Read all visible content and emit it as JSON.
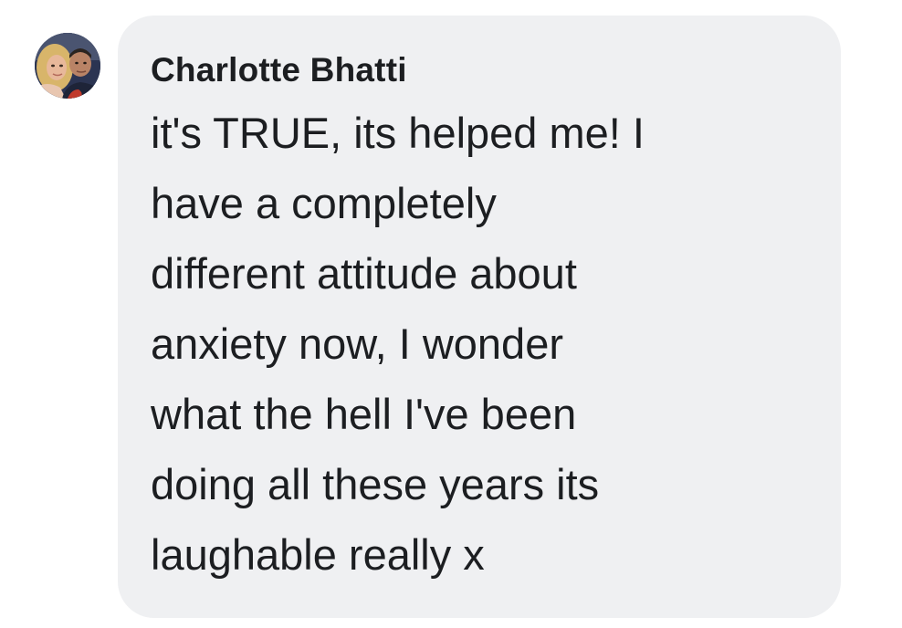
{
  "comment": {
    "author": "Charlotte Bhatti",
    "avatar_icon": "profile-photo-avatar",
    "bubble_color": "#eff0f2",
    "text_color": "#1c1e21",
    "lines": [
      "it's TRUE, its helped me! I",
      "have a completely",
      "different attitude about",
      "anxiety now, I wonder",
      "what the hell I've been",
      "doing all these years its",
      "laughable really x"
    ]
  }
}
